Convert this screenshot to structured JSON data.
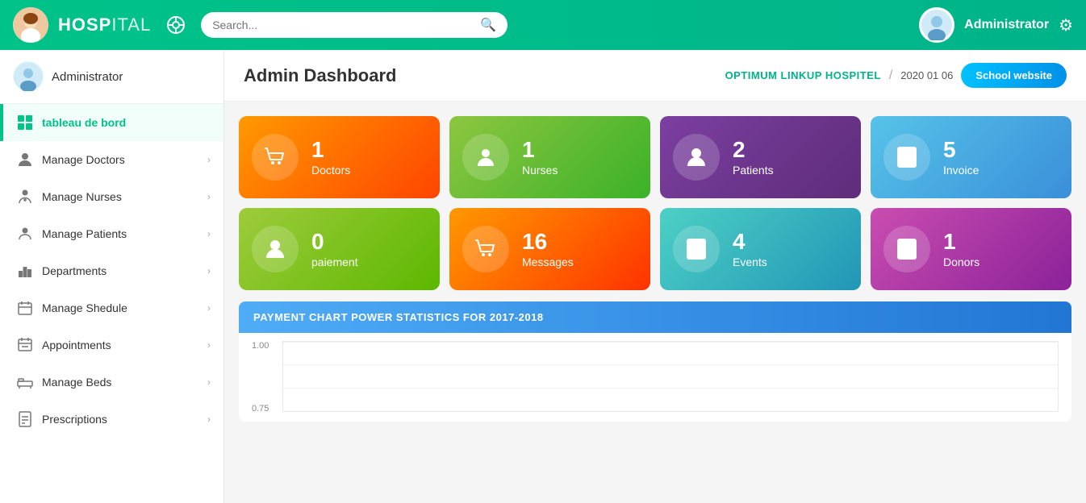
{
  "topnav": {
    "brand_bold": "HOSP",
    "brand_light": "ITAL",
    "search_placeholder": "Search...",
    "admin_name": "Administrator",
    "settings_label": "Settings"
  },
  "sidebar": {
    "user_name": "Administrator",
    "items": [
      {
        "id": "tableau-de-bord",
        "label": "tableau de bord",
        "icon": "dashboard",
        "active": true,
        "has_chevron": false
      },
      {
        "id": "manage-doctors",
        "label": "Manage Doctors",
        "icon": "doctor",
        "active": false,
        "has_chevron": true
      },
      {
        "id": "manage-nurses",
        "label": "Manage Nurses",
        "icon": "nurse",
        "active": false,
        "has_chevron": true
      },
      {
        "id": "manage-patients",
        "label": "Manage Patients",
        "icon": "patient",
        "active": false,
        "has_chevron": true
      },
      {
        "id": "departments",
        "label": "Departments",
        "icon": "department",
        "active": false,
        "has_chevron": true
      },
      {
        "id": "manage-shedule",
        "label": "Manage Shedule",
        "icon": "schedule",
        "active": false,
        "has_chevron": true
      },
      {
        "id": "appointments",
        "label": "Appointments",
        "icon": "appointment",
        "active": false,
        "has_chevron": true
      },
      {
        "id": "manage-beds",
        "label": "Manage Beds",
        "icon": "bed",
        "active": false,
        "has_chevron": true
      },
      {
        "id": "prescriptions",
        "label": "Prescriptions",
        "icon": "prescription",
        "active": false,
        "has_chevron": true
      }
    ]
  },
  "content": {
    "title": "Admin Dashboard",
    "breadcrumb": "OPTIMUM LINKUP HOSPITEL",
    "date": "2020 01 06",
    "school_website_btn": "School website"
  },
  "cards": [
    {
      "id": "doctors",
      "count": "1",
      "label": "Doctors",
      "gradient": "card-orange",
      "icon": "cart"
    },
    {
      "id": "nurses",
      "count": "1",
      "label": "Nurses",
      "gradient": "card-green",
      "icon": "user"
    },
    {
      "id": "patients",
      "count": "2",
      "label": "Patients",
      "gradient": "card-purple",
      "icon": "user-outline"
    },
    {
      "id": "invoice",
      "count": "5",
      "label": "Invoice",
      "gradient": "card-blue",
      "icon": "invoice"
    },
    {
      "id": "paiement",
      "count": "0",
      "label": "paiement",
      "gradient": "card-green2",
      "icon": "user-outline"
    },
    {
      "id": "messages",
      "count": "16",
      "label": "Messages",
      "gradient": "card-orange2",
      "icon": "cart"
    },
    {
      "id": "events",
      "count": "4",
      "label": "Events",
      "gradient": "card-teal",
      "icon": "invoice"
    },
    {
      "id": "donors",
      "count": "1",
      "label": "Donors",
      "gradient": "card-pink",
      "icon": "invoice"
    }
  ],
  "chart": {
    "title": "PAYMENT CHART POWER STATISTICS FOR 2017-2018",
    "y_labels": [
      "1.00",
      "0.75"
    ]
  }
}
